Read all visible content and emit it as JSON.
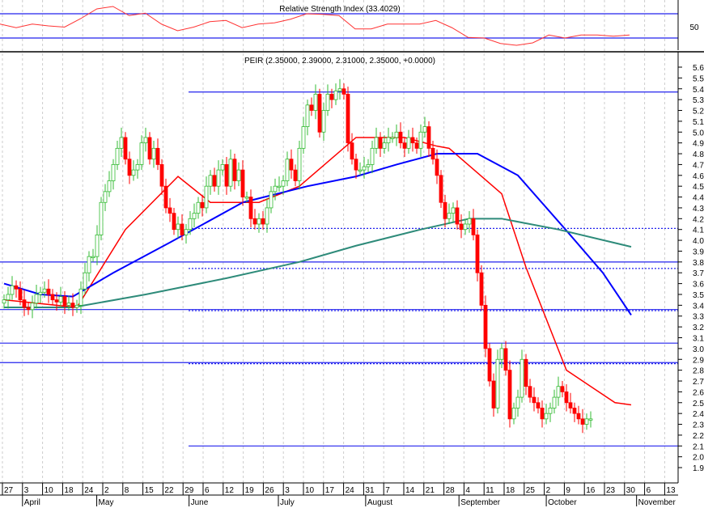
{
  "chart_data": {
    "type": "candlestick",
    "title": "PEIR (2.35000, 2.39000, 2.31000, 2.35000, +0.0000)",
    "rsi": {
      "title": "Relative Strength Index (33.4029)",
      "label_50": "50",
      "levels": [
        70,
        30
      ],
      "values": [
        53,
        47,
        53,
        50,
        48,
        62,
        78,
        82,
        67,
        71,
        53,
        42,
        48,
        57,
        59,
        47,
        53,
        55,
        61,
        70,
        69,
        67,
        45,
        45,
        53,
        53,
        53,
        59,
        47,
        31,
        30,
        21,
        18,
        22,
        35,
        30,
        35,
        35,
        33,
        35
      ]
    },
    "y_ticks": [
      "5.6",
      "5.5",
      "5.4",
      "5.3",
      "5.2",
      "5.1",
      "5.0",
      "4.9",
      "4.8",
      "4.7",
      "4.6",
      "4.5",
      "4.4",
      "4.3",
      "4.2",
      "4.1",
      "4.0",
      "3.9",
      "3.8",
      "3.7",
      "3.6",
      "3.5",
      "3.4",
      "3.3",
      "3.2",
      "3.1",
      "3.0",
      "2.9",
      "2.8",
      "2.7",
      "2.6",
      "2.5",
      "2.4",
      "2.3",
      "2.2",
      "2.1",
      "2.0",
      "1.9"
    ],
    "ylim": [
      1.85,
      5.7
    ],
    "x_week_labels": [
      "27",
      "3",
      "10",
      "18",
      "24",
      "2",
      "8",
      "15",
      "22",
      "29",
      "6",
      "12",
      "19",
      "26",
      "3",
      "10",
      "17",
      "24",
      "31",
      "7",
      "14",
      "21",
      "28",
      "4",
      "11",
      "18",
      "25",
      "2",
      "9",
      "16",
      "23",
      "30",
      "6",
      "13"
    ],
    "x_month_labels": [
      "April",
      "May",
      "June",
      "July",
      "August",
      "September",
      "October",
      "November"
    ],
    "closes": [
      3.45,
      3.5,
      3.58,
      3.55,
      3.45,
      3.38,
      3.36,
      3.42,
      3.5,
      3.52,
      3.55,
      3.5,
      3.45,
      3.43,
      3.48,
      3.4,
      3.42,
      3.38,
      3.4,
      3.55,
      3.7,
      3.85,
      3.85,
      4.05,
      4.35,
      4.45,
      4.55,
      4.7,
      4.85,
      4.95,
      4.75,
      4.6,
      4.65,
      4.7,
      4.9,
      4.95,
      4.75,
      4.85,
      4.7,
      4.5,
      4.3,
      4.25,
      4.1,
      4.15,
      4.05,
      4.1,
      4.2,
      4.25,
      4.35,
      4.3,
      4.5,
      4.6,
      4.5,
      4.65,
      4.7,
      4.5,
      4.75,
      4.55,
      4.65,
      4.4,
      4.4,
      4.2,
      4.15,
      4.2,
      4.15,
      4.3,
      4.45,
      4.5,
      4.5,
      4.55,
      4.75,
      4.65,
      4.55,
      4.85,
      5.05,
      5.25,
      5.2,
      5.35,
      5.0,
      5.2,
      5.35,
      5.3,
      5.38,
      5.4,
      5.35,
      4.9,
      4.75,
      4.65,
      4.65,
      4.68,
      4.7,
      4.85,
      4.95,
      4.85,
      4.9,
      4.95,
      4.95,
      5.0,
      4.9,
      4.85,
      4.95,
      4.9,
      4.85,
      5.0,
      5.05,
      4.85,
      4.75,
      4.6,
      4.35,
      4.2,
      4.25,
      4.3,
      4.15,
      4.1,
      4.15,
      4.2,
      4.05,
      3.7,
      3.4,
      3.0,
      2.7,
      2.45,
      2.9,
      3.0,
      2.8,
      2.35,
      2.45,
      2.55,
      2.9,
      2.65,
      2.55,
      2.5,
      2.45,
      2.35,
      2.4,
      2.45,
      2.55,
      2.65,
      2.6,
      2.5,
      2.45,
      2.4,
      2.35,
      2.3,
      2.35,
      2.35
    ],
    "moving_averages": [
      {
        "name": "short",
        "color": "#ff0000",
        "points": [
          [
            0,
            3.45
          ],
          [
            18,
            3.38
          ],
          [
            30,
            4.1
          ],
          [
            43,
            4.59
          ],
          [
            51,
            4.35
          ],
          [
            63,
            4.35
          ],
          [
            73,
            4.5
          ],
          [
            87,
            4.95
          ],
          [
            99,
            4.95
          ],
          [
            107,
            4.87
          ],
          [
            110,
            4.85
          ],
          [
            123,
            4.43
          ],
          [
            129,
            3.75
          ],
          [
            139,
            2.8
          ],
          [
            145,
            2.65
          ],
          [
            151,
            2.5
          ],
          [
            155,
            2.48
          ]
        ]
      },
      {
        "name": "medium",
        "color": "#0000ff",
        "points": [
          [
            0,
            3.6
          ],
          [
            9,
            3.5
          ],
          [
            17,
            3.48
          ],
          [
            27,
            3.7
          ],
          [
            41,
            3.98
          ],
          [
            59,
            4.35
          ],
          [
            75,
            4.5
          ],
          [
            87,
            4.59
          ],
          [
            97,
            4.7
          ],
          [
            107,
            4.8
          ],
          [
            117,
            4.8
          ],
          [
            127,
            4.6
          ],
          [
            139,
            4.09
          ],
          [
            148,
            3.7
          ],
          [
            155,
            3.31
          ]
        ]
      },
      {
        "name": "long",
        "color": "#2e8b7a",
        "points": [
          [
            0,
            3.38
          ],
          [
            17,
            3.38
          ],
          [
            35,
            3.5
          ],
          [
            55,
            3.65
          ],
          [
            73,
            3.8
          ],
          [
            87,
            3.95
          ],
          [
            103,
            4.1
          ],
          [
            115,
            4.2
          ],
          [
            123,
            4.2
          ],
          [
            137,
            4.1
          ],
          [
            155,
            3.94
          ]
        ]
      }
    ],
    "horizontal_lines": [
      {
        "value": 5.37,
        "style": "solid",
        "from": "June"
      },
      {
        "value": 4.11,
        "style": "dotted",
        "from": "June"
      },
      {
        "value": 3.8,
        "style": "solid",
        "from": "start"
      },
      {
        "value": 3.74,
        "style": "dotted",
        "from": "June"
      },
      {
        "value": 3.36,
        "style": "solid",
        "from": "start"
      },
      {
        "value": 3.35,
        "style": "dotted",
        "from": "June"
      },
      {
        "value": 3.05,
        "style": "solid",
        "from": "start"
      },
      {
        "value": 2.87,
        "style": "solid",
        "from": "start"
      },
      {
        "value": 2.86,
        "style": "dotted",
        "from": "June"
      },
      {
        "value": 2.1,
        "style": "solid",
        "from": "June"
      }
    ],
    "colors": {
      "up": "#33bb33",
      "down": "#ff0000",
      "level": "#2222ee",
      "rsi": "#ff3333"
    }
  }
}
